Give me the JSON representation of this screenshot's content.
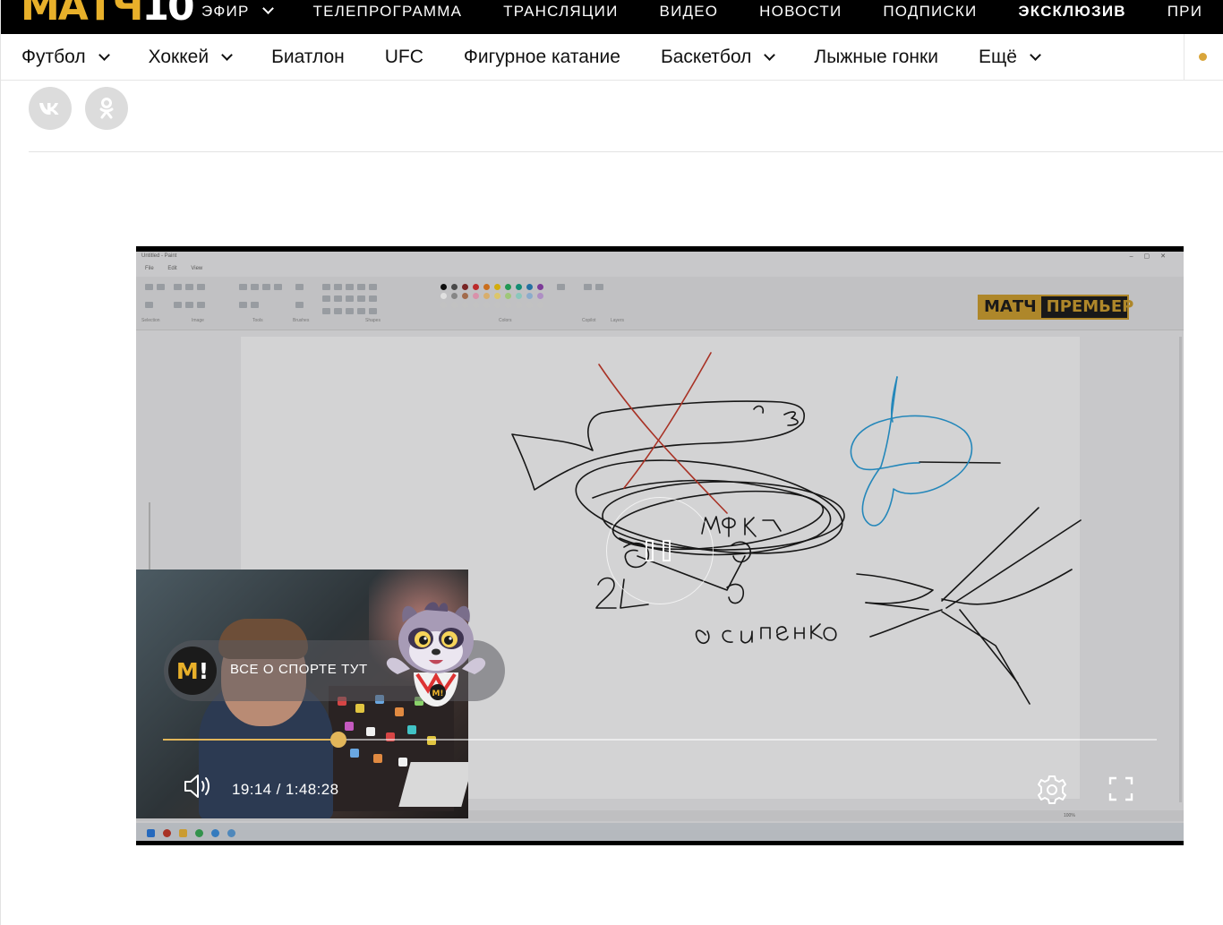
{
  "header": {
    "logo_main": "МАТЧ",
    "logo_ten": "10",
    "nav": [
      {
        "label": "ЭФИР",
        "dropdown": true
      },
      {
        "label": "ТЕЛЕПРОГРАММА",
        "dropdown": false
      },
      {
        "label": "ТРАНСЛЯЦИИ",
        "dropdown": false
      },
      {
        "label": "ВИДЕО",
        "dropdown": false
      },
      {
        "label": "НОВОСТИ",
        "dropdown": false
      },
      {
        "label": "ПОДПИСКИ",
        "dropdown": false
      },
      {
        "label": "ЭКСКЛЮЗИВ",
        "dropdown": false,
        "bold": true
      },
      {
        "label": "ПРИ",
        "dropdown": false
      }
    ]
  },
  "sports_nav": [
    {
      "label": "Футбол",
      "dropdown": true
    },
    {
      "label": "Хоккей",
      "dropdown": true
    },
    {
      "label": "Биатлон",
      "dropdown": false
    },
    {
      "label": "UFC",
      "dropdown": false
    },
    {
      "label": "Фигурное катание",
      "dropdown": false
    },
    {
      "label": "Баскетбол",
      "dropdown": true
    },
    {
      "label": "Лыжные гонки",
      "dropdown": false
    },
    {
      "label": "Ещё",
      "dropdown": true
    }
  ],
  "share": {
    "vk_label": "vk",
    "ok_icon": "odnoklassniki-icon"
  },
  "video": {
    "channel_badge_left": "МАТЧ",
    "channel_badge_right": "ПРЕМЬЕР",
    "paint": {
      "app_title": "Untitled - Paint",
      "menu": "File Edit View",
      "ribbon_labels": [
        "Selection",
        "Image",
        "Tools",
        "Brushes",
        "Shapes",
        "Colors",
        "Copilot",
        "Layers"
      ],
      "zoom": "100%"
    },
    "drawing_text": {
      "label_number": "21",
      "label_name": "Осипенко",
      "label_center": "МФК"
    },
    "promo_logo": "M",
    "promo_text": "ВСЕ О СПОРТЕ ТУТ",
    "current_time": "19:14",
    "duration": "1:48:28",
    "progress": 0.1769,
    "time_separator": " / ",
    "icons": {
      "pause": "pause-icon",
      "volume": "volume-icon",
      "settings": "gear-icon",
      "fullscreen": "fullscreen-icon"
    }
  },
  "colors": {
    "accent": "#e2b65a",
    "logo_gold": "#e8b02a",
    "header_bg": "#000000"
  }
}
